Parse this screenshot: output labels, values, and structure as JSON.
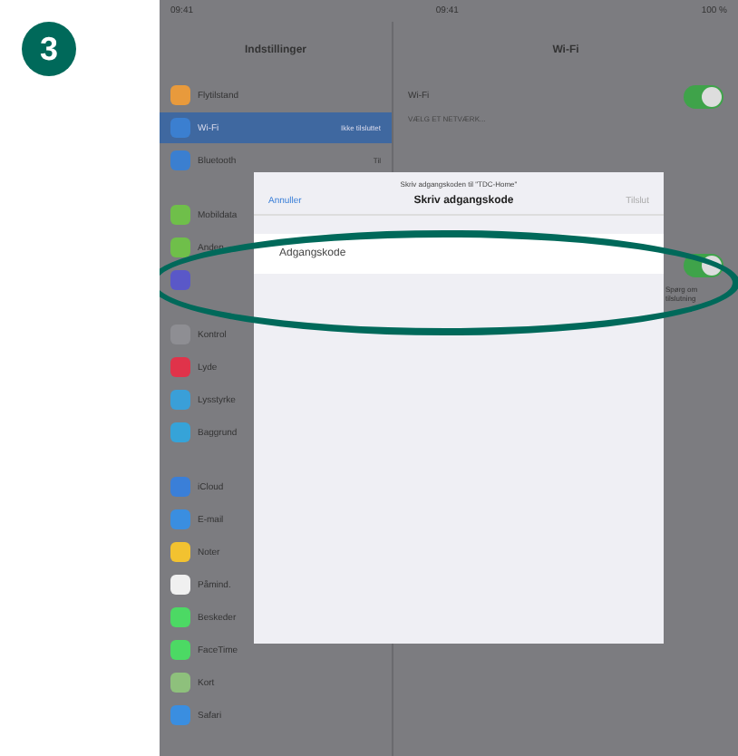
{
  "step": {
    "number": "3"
  },
  "status_bar": {
    "time_left": "09:41",
    "time_center": "09:41",
    "battery": "100 %"
  },
  "sidebar": {
    "title": "Indstillinger",
    "groups": [
      {
        "items": [
          {
            "label": "Flytilstand",
            "color": "#e89a3c",
            "selected": false
          },
          {
            "label": "Wi-Fi",
            "value": "Ikke tilsluttet",
            "color": "#3b7fd0",
            "selected": true
          },
          {
            "label": "Bluetooth",
            "value": "Til",
            "color": "#3b7fd0",
            "selected": false
          }
        ]
      },
      {
        "items": [
          {
            "label": "Mobildata",
            "color": "#6fbf4a",
            "selected": false
          },
          {
            "label": "Anden",
            "color": "#6fbf4a",
            "selected": false
          },
          {
            "color": "#5a58c8",
            "selected": false
          }
        ]
      },
      {
        "items": [
          {
            "label": "Kontrol",
            "color": "#8e8e93",
            "selected": false
          },
          {
            "label": "Lyde",
            "color": "#e0334a",
            "selected": false
          },
          {
            "label": "Lysstyrke",
            "color": "#3a9fd8",
            "selected": false
          },
          {
            "label": "Baggrund",
            "color": "#36a3d8",
            "selected": false
          }
        ]
      },
      {
        "items": [
          {
            "label": "iCloud",
            "color": "#3a7fd8",
            "selected": false
          },
          {
            "label": "E-mail",
            "color": "#3a8ee0",
            "selected": false
          },
          {
            "label": "Noter",
            "color": "#f2c230",
            "selected": false
          },
          {
            "label": "Påmind.",
            "color": "#f0f0f0",
            "selected": false
          },
          {
            "label": "Beskeder",
            "color": "#4cd964",
            "selected": false
          },
          {
            "label": "FaceTime",
            "color": "#4cd964",
            "selected": false
          },
          {
            "label": "Kort",
            "color": "#8ec07c",
            "selected": false
          },
          {
            "label": "Safari",
            "color": "#3a8ee0",
            "selected": false
          }
        ]
      }
    ]
  },
  "detail": {
    "title": "Wi-Fi",
    "wifi_label": "Wi-Fi",
    "wifi_on": true,
    "section": "VÆLG ET NETVÆRK...",
    "second_on": true,
    "note": "Spørg om tilslutning"
  },
  "dialog": {
    "prompt": "Skriv adgangskoden til \"TDC-Home\"",
    "cancel": "Annuller",
    "title": "Skriv adgangskode",
    "join": "Tilslut",
    "field": {
      "placeholder": "Adgangskode"
    }
  }
}
